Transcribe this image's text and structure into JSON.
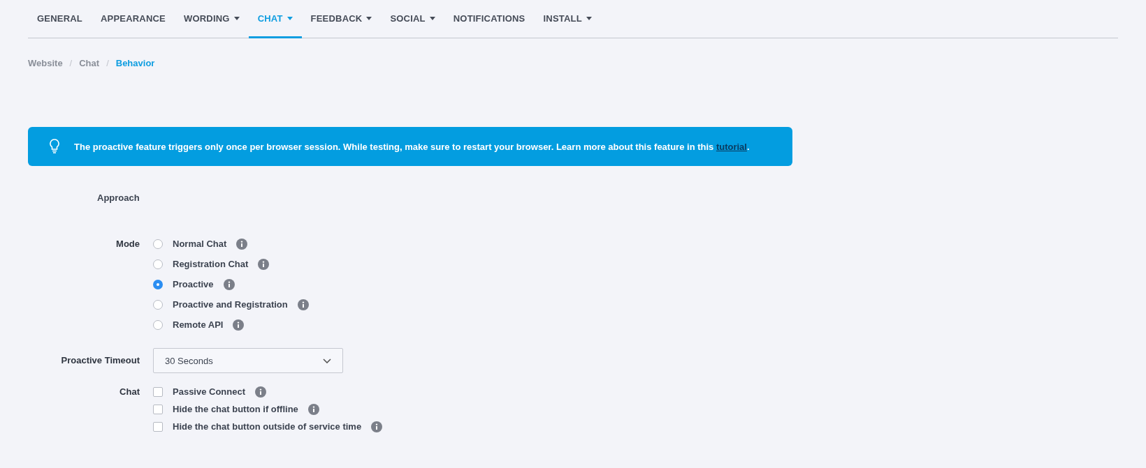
{
  "tabs": [
    {
      "label": "GENERAL",
      "selected": false,
      "dropdown": false
    },
    {
      "label": "APPEARANCE",
      "selected": false,
      "dropdown": false
    },
    {
      "label": "WORDING",
      "selected": false,
      "dropdown": true
    },
    {
      "label": "CHAT",
      "selected": true,
      "dropdown": true
    },
    {
      "label": "FEEDBACK",
      "selected": false,
      "dropdown": true
    },
    {
      "label": "SOCIAL",
      "selected": false,
      "dropdown": true
    },
    {
      "label": "NOTIFICATIONS",
      "selected": false,
      "dropdown": false
    },
    {
      "label": "INSTALL",
      "selected": false,
      "dropdown": true
    }
  ],
  "breadcrumb": [
    {
      "label": "Website",
      "selected": false
    },
    {
      "label": "Chat",
      "selected": false
    },
    {
      "label": "Behavior",
      "selected": true
    }
  ],
  "breadcrumb_separator": "/",
  "banner": {
    "text": "The proactive feature triggers only once per browser session. While testing, make sure to restart your browser. Learn more about this feature in this ",
    "link": "tutorial",
    "after": "."
  },
  "section_title": "Approach",
  "mode": {
    "label": "Mode",
    "options": [
      {
        "label": "Normal Chat",
        "selected": false,
        "info": true
      },
      {
        "label": "Registration Chat",
        "selected": false,
        "info": true
      },
      {
        "label": "Proactive",
        "selected": true,
        "info": true
      },
      {
        "label": "Proactive and Registration",
        "selected": false,
        "info": true
      },
      {
        "label": "Remote API",
        "selected": false,
        "info": true
      }
    ]
  },
  "proactive_timeout": {
    "label": "Proactive Timeout",
    "value": "30 Seconds"
  },
  "chat": {
    "label": "Chat",
    "options": [
      {
        "label": "Passive Connect",
        "checked": false,
        "info": true
      },
      {
        "label": "Hide the chat button if offline",
        "checked": false,
        "info": true
      },
      {
        "label": "Hide the chat button outside of service time",
        "checked": false,
        "info": true
      }
    ]
  }
}
